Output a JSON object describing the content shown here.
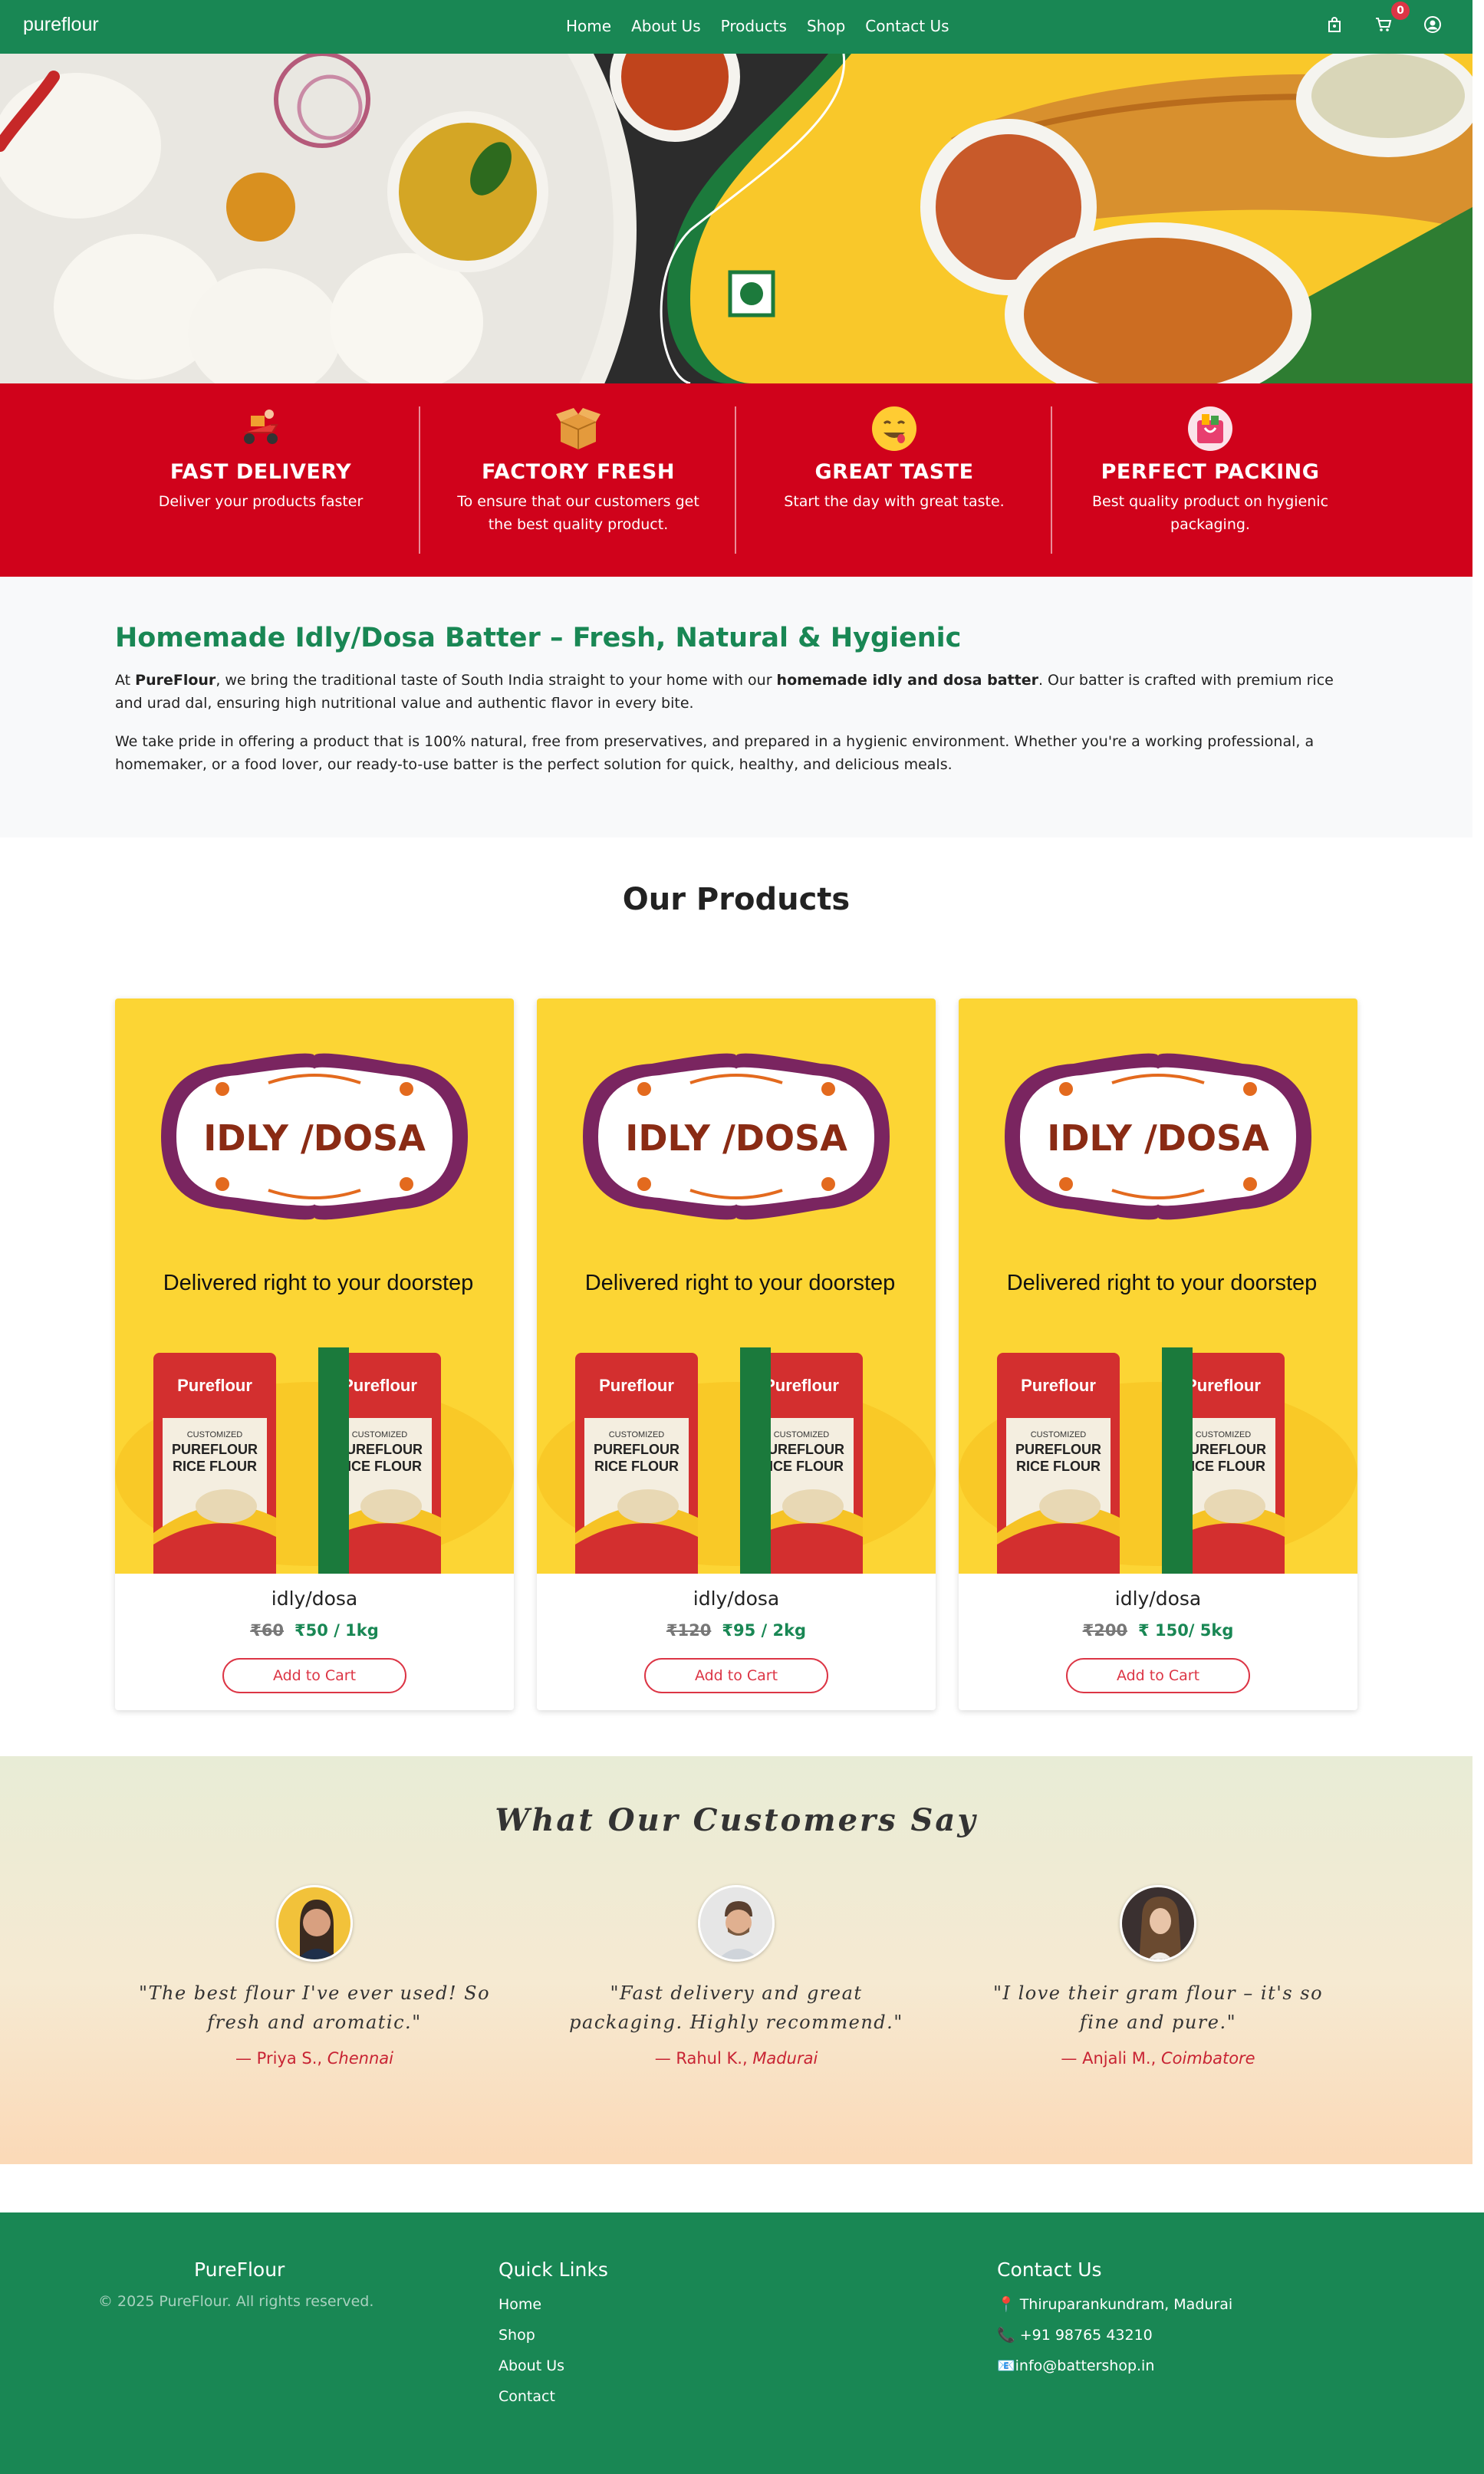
{
  "navbar": {
    "brand": "pureflour",
    "links": [
      "Home",
      "About Us",
      "Products",
      "Shop",
      "Contact Us"
    ],
    "cart_count": "0",
    "icons": [
      "bag-icon",
      "cart-icon",
      "user-icon"
    ]
  },
  "features": [
    {
      "title": "FAST DELIVERY",
      "text": "Deliver your products faster",
      "icon": "scooter-icon"
    },
    {
      "title": "FACTORY FRESH",
      "text": "To ensure that our customers get the best quality product.",
      "icon": "box-icon"
    },
    {
      "title": "GREAT TASTE",
      "text": "Start the day with great taste.",
      "icon": "smiley-icon"
    },
    {
      "title": "PERFECT PACKING",
      "text": "Best quality product on hygienic packaging.",
      "icon": "package-icon"
    }
  ],
  "about": {
    "title": "Homemade Idly/Dosa Batter – Fresh, Natural & Hygienic",
    "p1_a": "At ",
    "p1_brand": "PureFlour",
    "p1_b": ", we bring the traditional taste of South India straight to your home with our ",
    "p1_bold": "homemade idly and dosa batter",
    "p1_c": ". Our batter is crafted with premium rice and urad dal, ensuring high nutritional value and authentic flavor in every bite.",
    "p2": "We take pride in offering a product that is 100% natural, free from preservatives, and prepared in a hygienic environment. Whether you're a working professional, a homemaker, or a food lover, our ready-to-use batter is the perfect solution for quick, healthy, and delicious meals."
  },
  "products": {
    "heading": "Our Products",
    "button_label": "Add to Cart",
    "image_texts": {
      "label": "IDLY /DOSA",
      "tagline": "Delivered right to your doorstep",
      "pack_brand": "Pureflour",
      "pack_line1": "CUSTOMIZED",
      "pack_line2": "PUREFLOUR",
      "pack_line3": "RICE FLOUR"
    },
    "items": [
      {
        "name": "idly/dosa",
        "old_price": "₹60",
        "new_price": "₹50 / 1kg"
      },
      {
        "name": "idly/dosa",
        "old_price": "₹120",
        "new_price": "₹95 / 2kg"
      },
      {
        "name": "idly/dosa",
        "old_price": "₹200",
        "new_price": "₹ 150/ 5kg"
      }
    ]
  },
  "testimonials": {
    "heading": "What Our Customers Say",
    "items": [
      {
        "quote": "\"The best flour I've ever used! So fresh and aromatic.\"",
        "name": "— Priya S., ",
        "city": "Chennai"
      },
      {
        "quote": "\"Fast delivery and great packaging. Highly recommend.\"",
        "name": "— Rahul K., ",
        "city": "Madurai"
      },
      {
        "quote": "\"I love their gram flour – it's so fine and pure.\"",
        "name": "— Anjali M., ",
        "city": "Coimbatore"
      }
    ]
  },
  "footer": {
    "brand": "PureFlour",
    "copyright": "© 2025 PureFlour. All rights reserved.",
    "quick_links_title": "Quick Links",
    "quick_links": [
      "Home",
      "Shop",
      "About Us",
      "Contact"
    ],
    "contact_title": "Contact Us",
    "address": "📍 Thiruparankundram, Madurai",
    "phone": "📞 +91 98765 43210",
    "email": "📧info@battershop.in"
  },
  "colors": {
    "primary": "#198754",
    "accent": "#dc3545",
    "feature_bg": "#d0021b",
    "product_bg": "#fcd534"
  }
}
